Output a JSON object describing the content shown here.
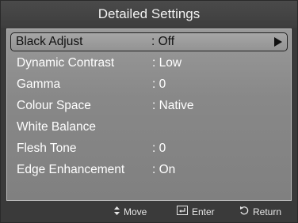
{
  "header": {
    "title": "Detailed Settings"
  },
  "menu": {
    "items": [
      {
        "label": "Black Adjust",
        "value": ": Off"
      },
      {
        "label": "Dynamic Contrast",
        "value": ": Low"
      },
      {
        "label": "Gamma",
        "value": ": 0"
      },
      {
        "label": "Colour Space",
        "value": ": Native"
      },
      {
        "label": "White Balance",
        "value": ""
      },
      {
        "label": "Flesh Tone",
        "value": ": 0"
      },
      {
        "label": "Edge Enhancement",
        "value": ": On"
      }
    ],
    "selected_index": 0
  },
  "footer": {
    "move": "Move",
    "enter": "Enter",
    "return": "Return"
  },
  "icons": {
    "move": "up-down-arrows-icon",
    "enter": "enter-icon",
    "return": "return-icon",
    "submenu": "right-arrow-icon"
  },
  "colors": {
    "panel": "#8c8c8c",
    "header": "#444444",
    "highlight_border": "#222222"
  }
}
